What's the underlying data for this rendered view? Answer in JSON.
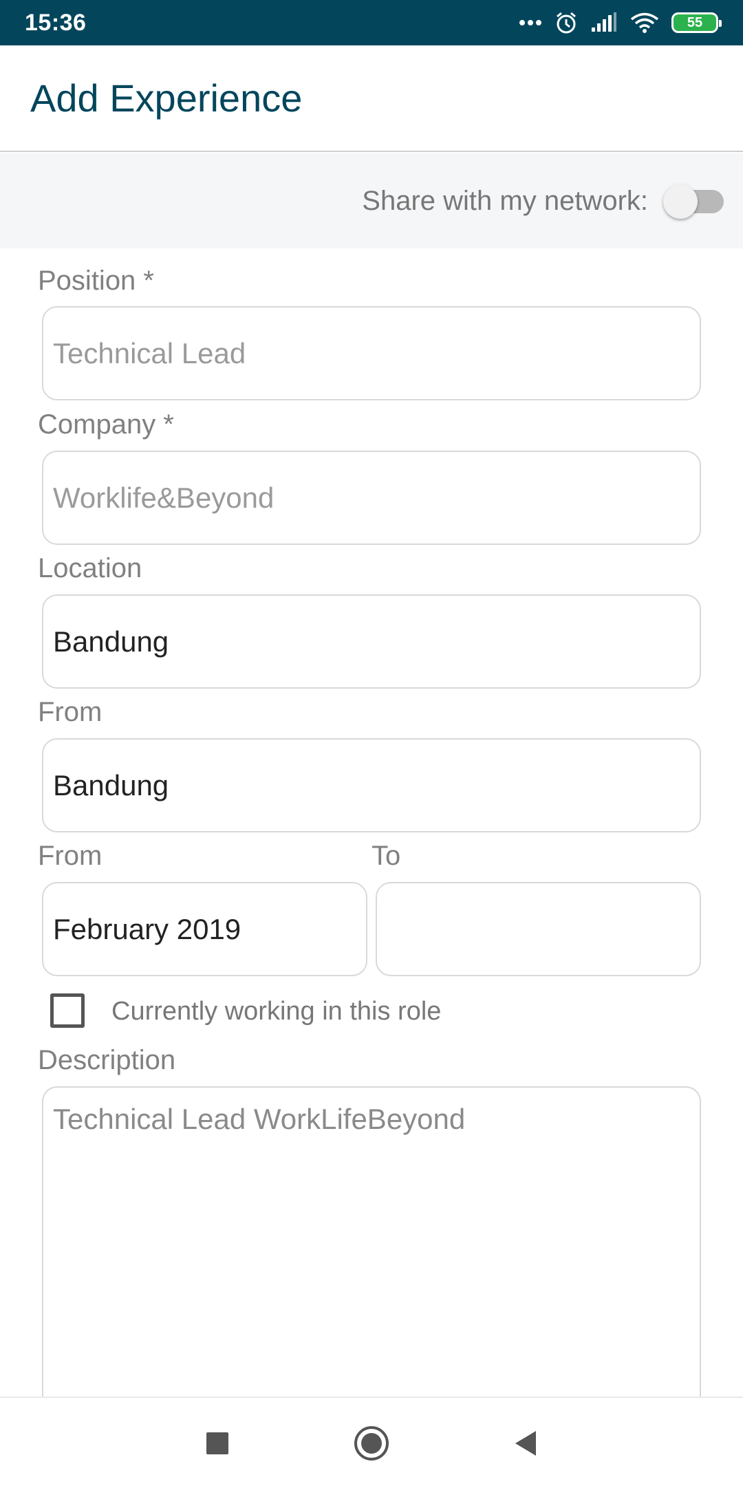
{
  "status_bar": {
    "time": "15:36",
    "battery": "55",
    "icons": [
      "more-dots-icon",
      "alarm-icon",
      "signal-icon",
      "wifi-icon",
      "battery-icon"
    ]
  },
  "app_bar": {
    "title": "Add Experience"
  },
  "share": {
    "label": "Share with my network:",
    "enabled": false
  },
  "form": {
    "position": {
      "label": "Position *",
      "placeholder": "Technical Lead",
      "value": ""
    },
    "company": {
      "label": "Company *",
      "placeholder": "Worklife&Beyond",
      "value": ""
    },
    "location": {
      "label": "Location",
      "value": "Bandung"
    },
    "from_location": {
      "label": "From",
      "value": "Bandung"
    },
    "from_date": {
      "label": "From",
      "value": "February 2019"
    },
    "to_date": {
      "label": "To",
      "value": ""
    },
    "currently_working": {
      "label": "Currently working in this role",
      "checked": false
    },
    "description": {
      "label": "Description",
      "placeholder": "Technical Lead WorkLifeBeyond"
    }
  },
  "nav_bar": {
    "buttons": [
      "recents-icon",
      "home-icon",
      "back-icon"
    ]
  },
  "colors": {
    "status_bar": "#03465c",
    "title": "#03465c",
    "share_background": "#f5f6f8",
    "battery": "#2bb24c"
  }
}
